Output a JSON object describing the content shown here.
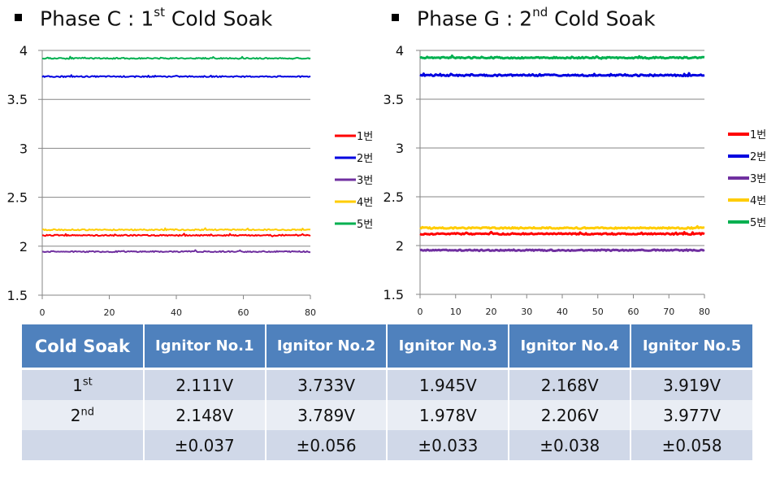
{
  "titles": [
    {
      "prefix": "Phase C : 1",
      "sup": "st",
      "suffix": " Cold Soak"
    },
    {
      "prefix": "Phase G : 2",
      "sup": "nd",
      "suffix": " Cold Soak"
    }
  ],
  "chart_data": [
    {
      "type": "line",
      "title": "Phase C : 1st Cold Soak",
      "xlabel": "",
      "ylabel": "",
      "xlim": [
        0,
        80
      ],
      "ylim": [
        1.5,
        4
      ],
      "xticks": [
        0,
        20,
        40,
        60,
        80
      ],
      "yticks": [
        1.5,
        2,
        2.5,
        3,
        3.5,
        4
      ],
      "ytick_labels": [
        "1.5",
        "2",
        "2.5",
        "3",
        "3.5",
        "4"
      ],
      "grid": "horizontal",
      "legend": "right",
      "series": [
        {
          "name": "1번",
          "color": "#ff0000",
          "mean": 2.111,
          "noise": 0.006
        },
        {
          "name": "2번",
          "color": "#0000e0",
          "mean": 3.733,
          "noise": 0.006
        },
        {
          "name": "3번",
          "color": "#7030a0",
          "mean": 1.945,
          "noise": 0.006
        },
        {
          "name": "4번",
          "color": "#ffcc00",
          "mean": 2.168,
          "noise": 0.006
        },
        {
          "name": "5번",
          "color": "#00b050",
          "mean": 3.919,
          "noise": 0.006
        }
      ]
    },
    {
      "type": "line",
      "title": "Phase G : 2nd Cold Soak",
      "xlabel": "",
      "ylabel": "",
      "xlim": [
        0,
        80
      ],
      "ylim": [
        1.5,
        4
      ],
      "xticks": [
        0,
        10,
        20,
        30,
        40,
        50,
        60,
        70,
        80
      ],
      "yticks": [
        1.5,
        2,
        2.5,
        3,
        3.5,
        4
      ],
      "ytick_labels": [
        "1.5",
        "2",
        "2.5",
        "3",
        "3.5",
        "4"
      ],
      "grid": "horizontal",
      "legend": "right",
      "series": [
        {
          "name": "1번",
          "color": "#ff0000",
          "mean": 2.12,
          "noise": 0.007
        },
        {
          "name": "2번",
          "color": "#0000e0",
          "mean": 3.745,
          "noise": 0.008
        },
        {
          "name": "3번",
          "color": "#7030a0",
          "mean": 1.952,
          "noise": 0.006
        },
        {
          "name": "4번",
          "color": "#ffcc00",
          "mean": 2.18,
          "noise": 0.007
        },
        {
          "name": "5번",
          "color": "#00b050",
          "mean": 3.925,
          "noise": 0.007
        }
      ]
    }
  ],
  "table": {
    "headers": [
      "Cold Soak",
      "Ignitor No.1",
      "Ignitor No.2",
      "Ignitor No.3",
      "Ignitor No.4",
      "Ignitor No.5"
    ],
    "rows": [
      {
        "label": "1",
        "label_sup": "st",
        "values": [
          "2.111V",
          "3.733V",
          "1.945V",
          "2.168V",
          "3.919V"
        ]
      },
      {
        "label": "2",
        "label_sup": "nd",
        "values": [
          "2.148V",
          "3.789V",
          "1.978V",
          "2.206V",
          "3.977V"
        ]
      },
      {
        "label": "",
        "label_sup": "",
        "values": [
          "±0.037",
          "±0.056",
          "±0.033",
          "±0.038",
          "±0.058"
        ]
      }
    ]
  }
}
